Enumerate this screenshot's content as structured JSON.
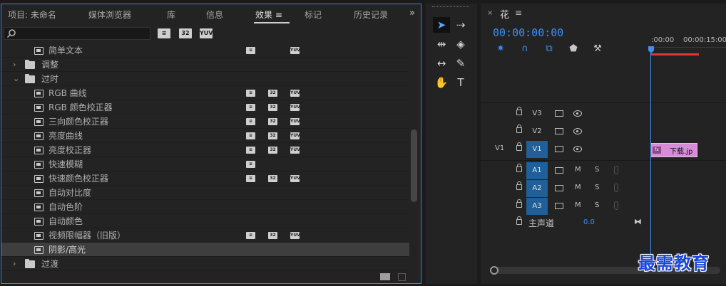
{
  "tabs": [
    {
      "label": "项目: 未命名",
      "active": false
    },
    {
      "label": "媒体浏览器",
      "active": false
    },
    {
      "label": "库",
      "active": false
    },
    {
      "label": "信息",
      "active": false
    },
    {
      "label": "效果 ≡",
      "active": true
    },
    {
      "label": "标记",
      "active": false
    },
    {
      "label": "历史记录",
      "active": false
    }
  ],
  "overflow_label": "»",
  "search": {
    "value": "",
    "placeholder": ""
  },
  "filter_buttons": [
    "32",
    "YUV"
  ],
  "tree": [
    {
      "kind": "effect",
      "label": "简单文本",
      "badges": [
        "accel",
        "yuv"
      ]
    },
    {
      "kind": "folder",
      "label": "调整",
      "expanded": false
    },
    {
      "kind": "folder",
      "label": "过时",
      "expanded": true
    },
    {
      "kind": "effect",
      "label": "RGB 曲线",
      "badges": [
        "accel",
        "32",
        "yuv"
      ]
    },
    {
      "kind": "effect",
      "label": "RGB 颜色校正器",
      "badges": [
        "accel",
        "32",
        "yuv"
      ]
    },
    {
      "kind": "effect",
      "label": "三向颜色校正器",
      "badges": [
        "accel",
        "32",
        "yuv"
      ]
    },
    {
      "kind": "effect",
      "label": "亮度曲线",
      "badges": [
        "accel",
        "32",
        "yuv"
      ]
    },
    {
      "kind": "effect",
      "label": "亮度校正器",
      "badges": [
        "accel",
        "32",
        "yuv"
      ]
    },
    {
      "kind": "effect",
      "label": "快速模糊",
      "badges": [
        "accel"
      ]
    },
    {
      "kind": "effect",
      "label": "快速颜色校正器",
      "badges": [
        "accel",
        "32",
        "yuv"
      ]
    },
    {
      "kind": "effect",
      "label": "自动对比度",
      "badges": []
    },
    {
      "kind": "effect",
      "label": "自动色阶",
      "badges": []
    },
    {
      "kind": "effect",
      "label": "自动颜色",
      "badges": []
    },
    {
      "kind": "effect",
      "label": "视频限幅器（旧版）",
      "badges": [
        "accel",
        "32",
        "yuv"
      ]
    },
    {
      "kind": "effect",
      "label": "阴影/高光",
      "badges": [],
      "selected": true
    },
    {
      "kind": "folder",
      "label": "过渡",
      "expanded": false
    }
  ],
  "badge_text": {
    "32": "32",
    "yuv": "YUV",
    "accel": "≡"
  },
  "tools": [
    {
      "name": "selection-tool",
      "glyph": "➤",
      "active": true
    },
    {
      "name": "track-select-tool",
      "glyph": "⇢",
      "active": false
    },
    {
      "name": "ripple-edit-tool",
      "glyph": "⇹",
      "active": false
    },
    {
      "name": "razor-tool",
      "glyph": "◈",
      "active": false
    },
    {
      "name": "slip-tool",
      "glyph": "↔",
      "active": false
    },
    {
      "name": "pen-tool",
      "glyph": "✎",
      "active": false
    },
    {
      "name": "hand-tool",
      "glyph": "✋",
      "active": false
    },
    {
      "name": "type-tool",
      "glyph": "T",
      "active": false
    }
  ],
  "timeline": {
    "title": "花",
    "menu": "≡",
    "close": "×",
    "timecode": "00:00:00:00",
    "ruler": [
      ":00:00",
      "00:00:15:00"
    ],
    "video_tracks": [
      {
        "name": "V3",
        "source": "",
        "target": false
      },
      {
        "name": "V2",
        "source": "",
        "target": false
      },
      {
        "name": "V1",
        "source": "V1",
        "target": true
      }
    ],
    "audio_tracks": [
      {
        "name": "A1",
        "mute": "M",
        "solo": "S"
      },
      {
        "name": "A2",
        "mute": "M",
        "solo": "S"
      },
      {
        "name": "A3",
        "mute": "M",
        "solo": "S"
      }
    ],
    "master": {
      "label": "主声道",
      "value": "0.0",
      "end": "⧓"
    },
    "clip": {
      "fx": "fx",
      "label": "下载.jp"
    }
  },
  "watermark": "最需教育",
  "colors": {
    "accent": "#3d8ff5",
    "panel_border": "#2d8ceb",
    "clip": "#d88cd8",
    "work_area": "#e53434",
    "track_target": "#1f5f9a"
  }
}
